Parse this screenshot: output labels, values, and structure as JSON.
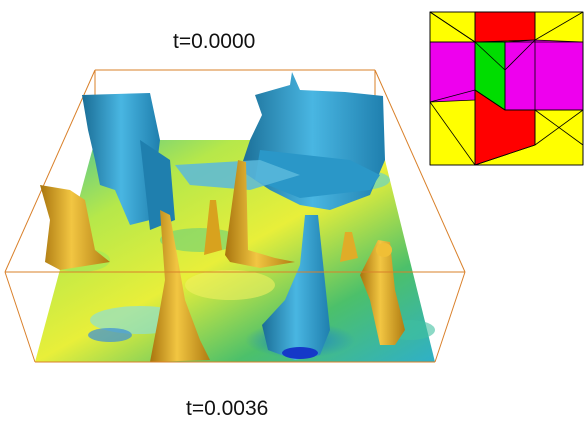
{
  "time_start_label": "t=0.0000",
  "time_end_label": "t=0.0036",
  "colors": {
    "background": "#ffffff",
    "box_outline": "#d9802a",
    "isosurface_blue": "#2a97c8",
    "isosurface_blue_dark": "#1a6d96",
    "isosurface_gold": "#d8a21e",
    "isosurface_gold_dark": "#a8740e",
    "mesh_yellow": "#ffff00",
    "mesh_red": "#ff0000",
    "mesh_green": "#00dd00",
    "mesh_magenta": "#ee00ee"
  },
  "icons": {
    "isosurface_view": "3d-isosurface-render",
    "mesh_inset": "triangle-mesh-partition"
  }
}
